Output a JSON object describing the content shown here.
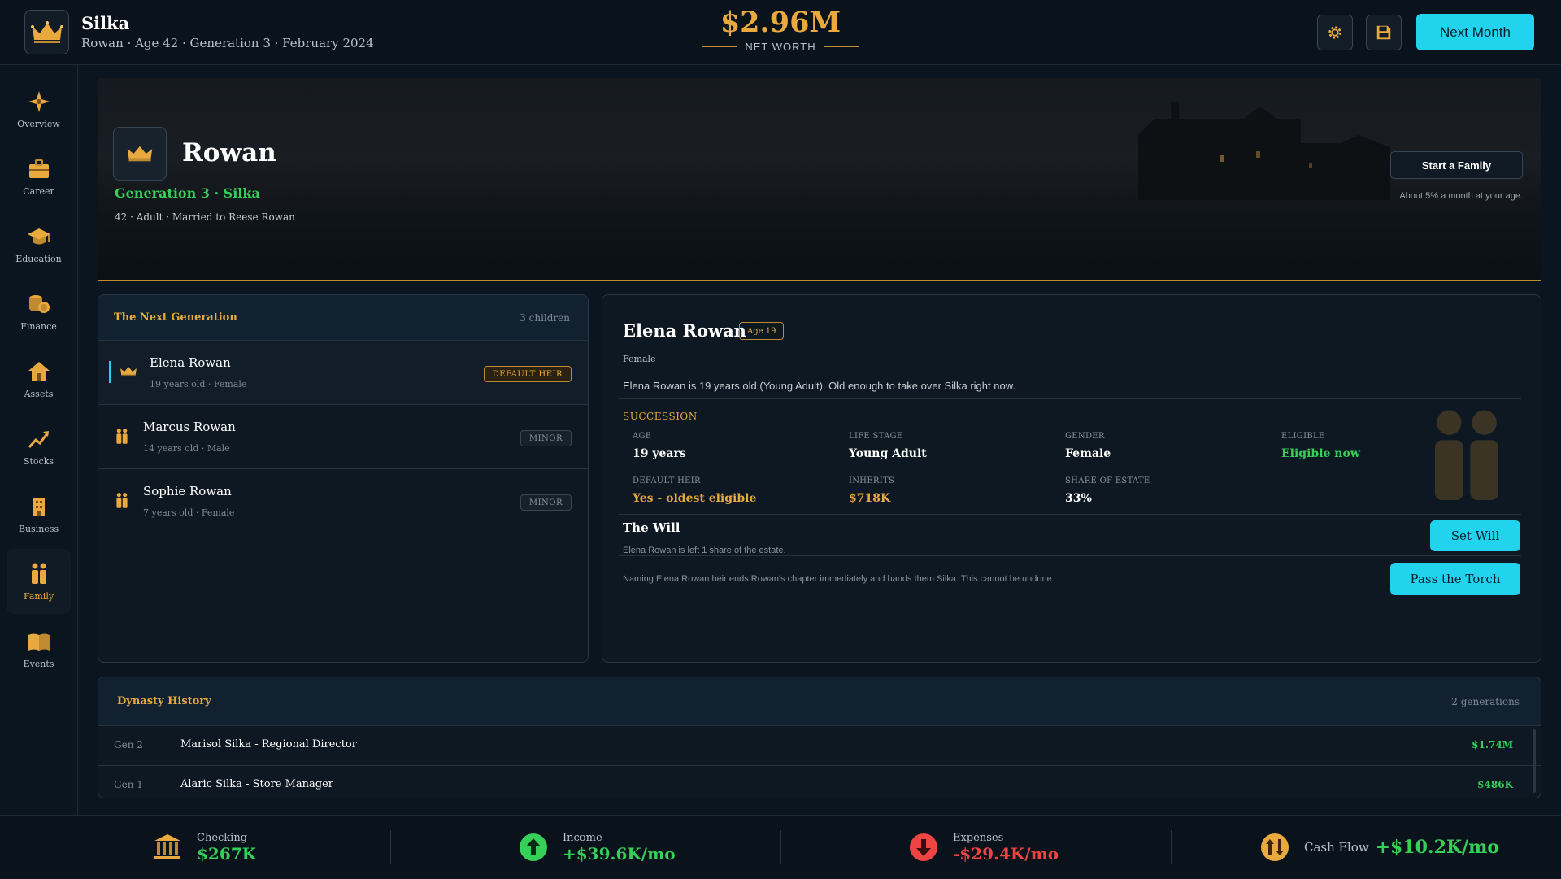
{
  "header": {
    "app_title": "Silka",
    "subtitle": "Rowan · Age 42 · Generation 3 · February 2024",
    "net_worth_value": "$2.96M",
    "net_worth_label": "NET WORTH",
    "next_month_label": "Next Month",
    "icons": [
      "crown-icon",
      "settings-icon",
      "save-icon"
    ]
  },
  "sidebar": {
    "items": [
      {
        "label": "Overview",
        "icon": "compass-icon"
      },
      {
        "label": "Career",
        "icon": "briefcase-icon"
      },
      {
        "label": "Education",
        "icon": "graduation-cap-icon"
      },
      {
        "label": "Finance",
        "icon": "coins-icon"
      },
      {
        "label": "Assets",
        "icon": "house-icon"
      },
      {
        "label": "Stocks",
        "icon": "trend-up-icon"
      },
      {
        "label": "Business",
        "icon": "building-icon"
      },
      {
        "label": "Family",
        "icon": "family-icon",
        "active": true
      },
      {
        "label": "Events",
        "icon": "book-icon"
      }
    ]
  },
  "hero": {
    "name": "Rowan",
    "generation": "Generation 3 · Silka",
    "info": "42 · Adult · Married to Reese Rowan",
    "start_family_label": "Start a Family",
    "start_family_note": "About 5% a month at your age."
  },
  "next_generation": {
    "title": "The Next Generation",
    "count": "3 children",
    "children": [
      {
        "name": "Elena Rowan",
        "meta": "19 years old · Female",
        "badge": "DEFAULT HEIR"
      },
      {
        "name": "Marcus Rowan",
        "meta": "14 years old · Male",
        "badge": "MINOR"
      },
      {
        "name": "Sophie Rowan",
        "meta": "7 years old · Female",
        "badge": "MINOR"
      }
    ]
  },
  "detail": {
    "name": "Elena Rowan",
    "age_badge": "Age 19",
    "gender": "Female",
    "description": "Elena Rowan is 19 years old (Young Adult). Old enough to take over Silka right now.",
    "succession_title": "SUCCESSION",
    "fields": [
      {
        "label": "AGE",
        "value": "19 years"
      },
      {
        "label": "LIFE STAGE",
        "value": "Young Adult"
      },
      {
        "label": "GENDER",
        "value": "Female"
      },
      {
        "label": "ELIGIBLE",
        "value": "Eligible now"
      },
      {
        "label": "DEFAULT HEIR",
        "value": "Yes - oldest eligible"
      },
      {
        "label": "INHERITS",
        "value": "$718K"
      },
      {
        "label": "SHARE OF ESTATE",
        "value": "33%"
      }
    ],
    "will_title": "The Will",
    "will_note": "Elena Rowan is left 1 share of the estate.",
    "set_will_label": "Set Will",
    "torch_note": "Naming Elena Rowan heir ends Rowan's chapter immediately and hands them Silka. This cannot be undone.",
    "pass_torch_label": "Pass the Torch"
  },
  "dynasty": {
    "title": "Dynasty History",
    "count": "2 generations",
    "rows": [
      {
        "gen": "Gen 2",
        "name": "Marisol Silka - Regional Director",
        "value": "$1.74M"
      },
      {
        "gen": "Gen 1",
        "name": "Alaric Silka - Store Manager",
        "value": "$486K"
      }
    ]
  },
  "footer": {
    "checking_label": "Checking",
    "checking_value": "$267K",
    "income_label": "Income",
    "income_value": "+$39.6K/mo",
    "expenses_label": "Expenses",
    "expenses_value": "-$29.4K/mo",
    "cashflow_label": "Cash Flow",
    "cashflow_value": "+$10.2K/mo"
  },
  "colors": {
    "accent_cyan": "#22d3ee",
    "gold": "#e8a93e",
    "positive": "#34d058",
    "negative": "#ef4444",
    "background": "#0b1520"
  }
}
